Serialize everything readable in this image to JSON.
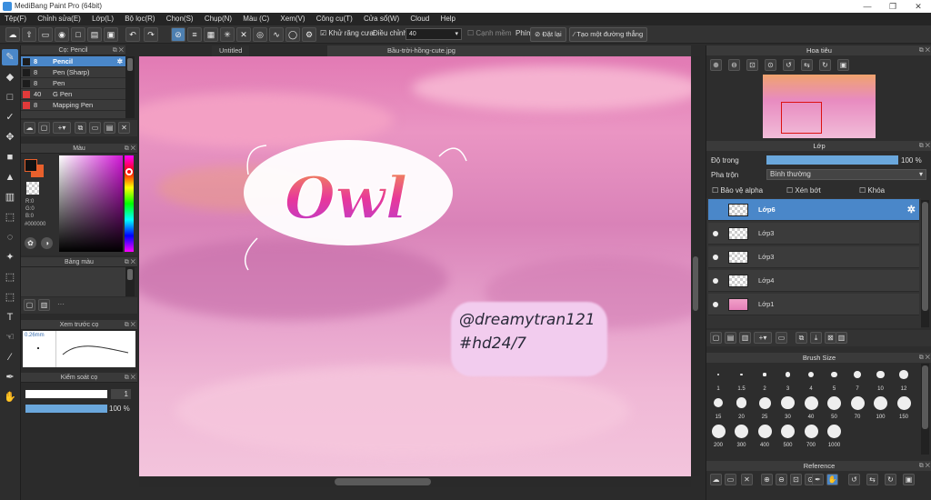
{
  "window": {
    "title": "MediBang Paint Pro (64bit)",
    "minimize": "—",
    "maximize": "❐",
    "close": "✕"
  },
  "menu": [
    "Tệp(F)",
    "Chỉnh sửa(E)",
    "Lớp(L)",
    "Bộ lọc(R)",
    "Chọn(S)",
    "Chụp(N)",
    "Màu (C)",
    "Xem(V)",
    "Công cụ(T)",
    "Cửa sổ(W)",
    "Cloud",
    "Help"
  ],
  "toolbar": {
    "antialias_label": "Khử răng cưa",
    "correction_label": "Điều chỉnh",
    "correction_value": "40",
    "soften_label": "Cạnh mềm",
    "key_label": "Phím",
    "reset_label": "Đặt lại",
    "create_path_label": "Tạo một đường thẳng"
  },
  "brush_panel": {
    "title": "Cọ: Pencil",
    "items": [
      {
        "size": "8",
        "name": "Pencil",
        "color": "#1c1c1c"
      },
      {
        "size": "8",
        "name": "Pen (Sharp)",
        "color": "#1c1c1c"
      },
      {
        "size": "8",
        "name": "Pen",
        "color": "#1c1c1c"
      },
      {
        "size": "40",
        "name": "G Pen",
        "color": "#e03a3a"
      },
      {
        "size": "8",
        "name": "Mapping Pen",
        "color": "#e03a3a"
      }
    ]
  },
  "color_panel": {
    "title": "Màu",
    "r": "R:0",
    "g": "G:0",
    "b": "B:0",
    "hex": "#000000",
    "fg": "#111111",
    "bg": "#e8602c"
  },
  "palette_panel": {
    "title": "Bảng màu",
    "more": "···"
  },
  "preview_panel": {
    "title": "Xem trước cọ",
    "size": "0.26mm"
  },
  "control_panel": {
    "title": "Kiểm soát cọ",
    "size_value": "1",
    "opacity_value": "100 %"
  },
  "tabs": {
    "untitled": "Untitled",
    "file": "Bầu-trời-hồng-cute.jpg"
  },
  "canvas": {
    "lettering": "Owl",
    "handwriting_line1": "@dreamytran121",
    "handwriting_line2": "#hd24/7"
  },
  "navigator": {
    "title": "Hoa tiêu"
  },
  "layer_panel": {
    "title": "Lớp",
    "opacity_label": "Độ trong",
    "opacity_value": "100 %",
    "opacity_fraction": 1.0,
    "blend_label": "Pha trộn",
    "blend_value": "Bình thường",
    "protect_alpha": "Bảo vệ alpha",
    "clipping": "Xén bớt",
    "lock": "Khóa",
    "layers": [
      {
        "name": "Lớp6",
        "selected": true
      },
      {
        "name": "Lớp3",
        "selected": false
      },
      {
        "name": "Lớp3",
        "selected": false
      },
      {
        "name": "Lớp4",
        "selected": false
      },
      {
        "name": "Lớp1",
        "selected": false
      }
    ]
  },
  "brush_size_panel": {
    "title": "Brush Size",
    "sizes": [
      "1",
      "1.5",
      "2",
      "3",
      "4",
      "5",
      "7",
      "10",
      "12",
      "15",
      "20",
      "25",
      "30",
      "40",
      "50",
      "70",
      "100",
      "150",
      "200",
      "300",
      "400",
      "500",
      "700",
      "1000"
    ]
  },
  "reference_panel": {
    "title": "Reference"
  },
  "colors": {
    "accent": "#4a87c9",
    "panel": "#2d2d2d",
    "canvas_pink": "#e68bbf"
  }
}
